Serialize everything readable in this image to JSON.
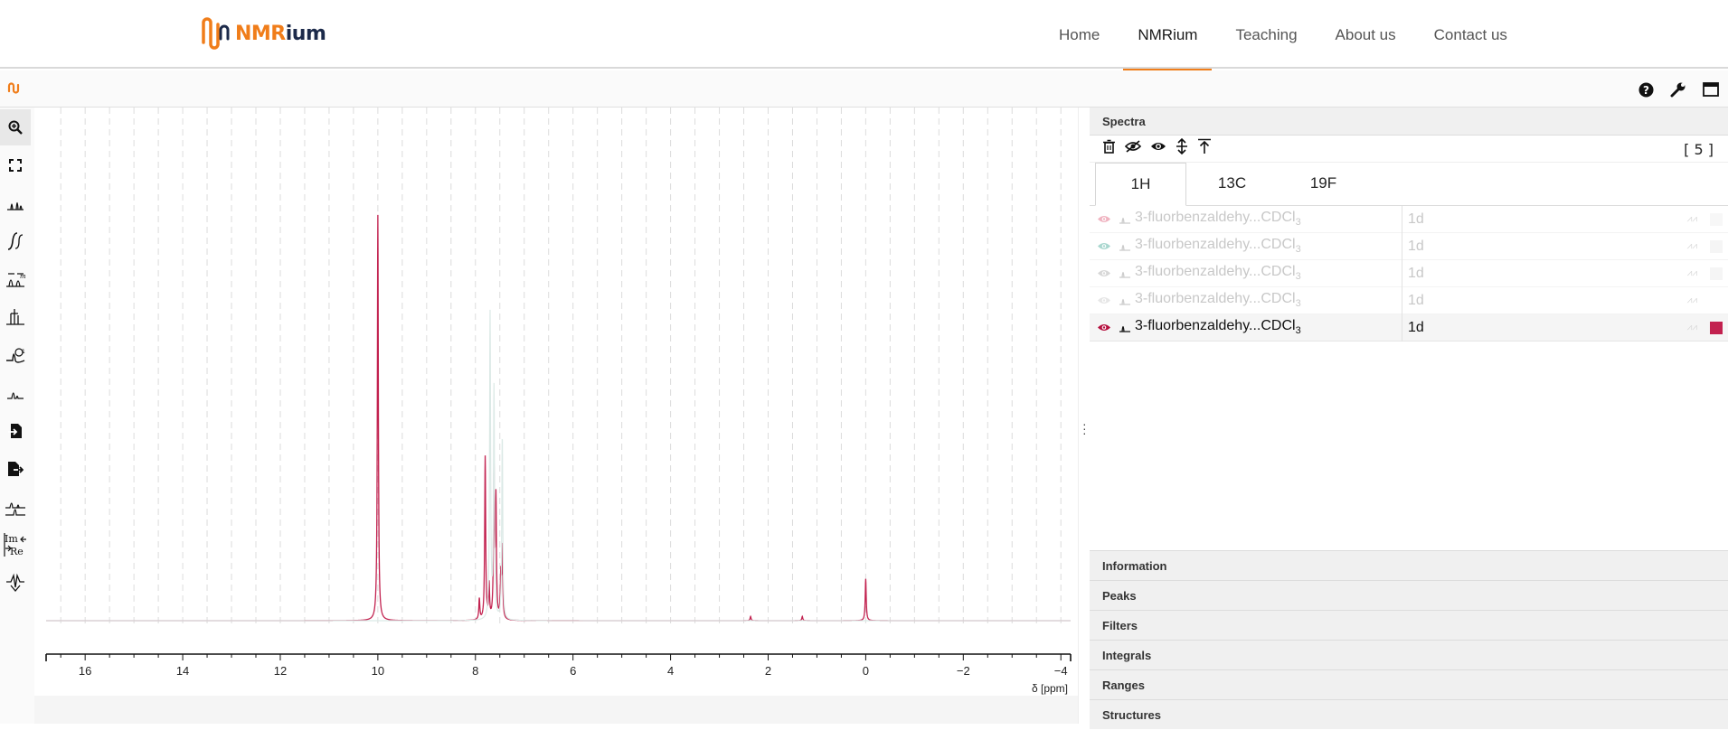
{
  "site": {
    "logo_nm": "NMR",
    "logo_rium": "ium",
    "nav": [
      {
        "label": "Home",
        "active": false
      },
      {
        "label": "NMRium",
        "active": true
      },
      {
        "label": "Teaching",
        "active": false
      },
      {
        "label": "About us",
        "active": false
      },
      {
        "label": "Contact us",
        "active": false
      }
    ]
  },
  "app_bar": {
    "icons": [
      "nmrium-logo-icon",
      "help-icon",
      "wrench-icon",
      "window-icon"
    ]
  },
  "tools": [
    {
      "name": "zoom-tool-icon",
      "active": true
    },
    {
      "name": "full-screen-icon",
      "active": false
    },
    {
      "name": "peak-picking-icon",
      "active": false
    },
    {
      "name": "integral-icon",
      "active": false
    },
    {
      "name": "range-picking-icon",
      "active": false
    },
    {
      "name": "multiplet-analysis-icon",
      "active": false
    },
    {
      "name": "phase-correction-icon",
      "active": false
    },
    {
      "name": "baseline-correction-icon",
      "active": false
    },
    {
      "name": "import-icon",
      "active": false
    },
    {
      "name": "export-icon",
      "active": false
    },
    {
      "name": "stack-spectra-icon",
      "active": false
    },
    {
      "name": "real-imaginary-icon",
      "active": false
    },
    {
      "name": "fid-icon",
      "active": false
    }
  ],
  "chart_data": {
    "type": "line",
    "xlabel": "δ [ppm]",
    "x_ticks": [
      "16",
      "14",
      "12",
      "10",
      "8",
      "6",
      "4",
      "2",
      "0",
      "−2",
      "−4"
    ],
    "xlim": [
      16.8,
      -4.2
    ],
    "reversed_x": true,
    "grid": true,
    "series": [
      {
        "color": "#c2214f",
        "peaks": [
          [
            10.0,
            0.97
          ],
          [
            7.8,
            0.39
          ],
          [
            7.72,
            0.08
          ],
          [
            7.62,
            0.36
          ],
          [
            7.58,
            0.28
          ],
          [
            7.45,
            0.17
          ],
          [
            7.48,
            0.1
          ],
          [
            7.92,
            0.05
          ],
          [
            0.0,
            0.1
          ],
          [
            2.36,
            0.01
          ],
          [
            1.3,
            0.01
          ]
        ]
      },
      {
        "color": "#dbe9e6",
        "peaks": [
          [
            7.7,
            0.73
          ],
          [
            7.62,
            0.55
          ],
          [
            7.45,
            0.44
          ]
        ]
      }
    ]
  },
  "panel": {
    "spectra_title": "Spectra",
    "count": "[ 5 ]",
    "tabs": [
      {
        "label": "1H",
        "active": true
      },
      {
        "label": "13C",
        "active": false
      },
      {
        "label": "19F",
        "active": false
      }
    ],
    "rows": [
      {
        "name": "3-fluorbenzaldehy...CDCl",
        "sub": "3",
        "kind": "1d",
        "eye_color": "#f0b3c0",
        "swatch": "#f7f7f7",
        "selected": false
      },
      {
        "name": "3-fluorbenzaldehy...CDCl",
        "sub": "3",
        "kind": "1d",
        "eye_color": "#a9d7cf",
        "swatch": "#f5f5f5",
        "selected": false
      },
      {
        "name": "3-fluorbenzaldehy...CDCl",
        "sub": "3",
        "kind": "1d",
        "eye_color": "#d7d7d7",
        "swatch": "#f5f5f5",
        "selected": false
      },
      {
        "name": "3-fluorbenzaldehy...CDCl",
        "sub": "3",
        "kind": "1d",
        "eye_color": "#e6e6e6",
        "swatch": "#ffffff",
        "selected": false
      },
      {
        "name": "3-fluorbenzaldehy...CDCl",
        "sub": "3",
        "kind": "1d",
        "eye_color": "#b5103e",
        "swatch": "#c2214f",
        "selected": true
      }
    ],
    "sections": [
      "Information",
      "Peaks",
      "Filters",
      "Integrals",
      "Ranges",
      "Structures"
    ]
  }
}
